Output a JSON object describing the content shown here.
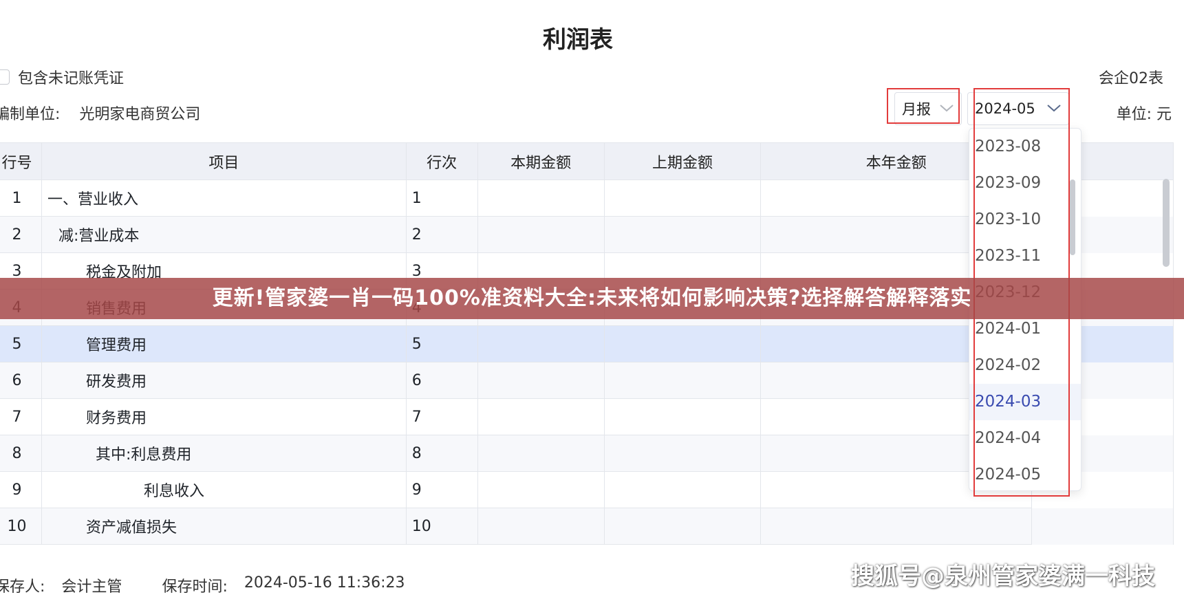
{
  "title": "利润表",
  "include_unposted_label": "包含未记账凭证",
  "form_code": "会企02表",
  "company": {
    "label": "编制单位:",
    "name": "光明家电商贸公司"
  },
  "period_select": {
    "value": "月报"
  },
  "month_select": {
    "value": "2024-05"
  },
  "unit_label": "单位:  元",
  "table": {
    "headers": [
      "行号",
      "项目",
      "行次",
      "本期金额",
      "上期金额",
      "本年金额"
    ],
    "rows": [
      {
        "no": "1",
        "item": "一、营业收入",
        "line": "1"
      },
      {
        "no": "2",
        "item": "减:营业成本",
        "line": "2"
      },
      {
        "no": "3",
        "item": "税金及附加",
        "line": "3"
      },
      {
        "no": "4",
        "item": "销售费用",
        "line": "4"
      },
      {
        "no": "5",
        "item": "管理费用",
        "line": "5"
      },
      {
        "no": "6",
        "item": "研发费用",
        "line": "6"
      },
      {
        "no": "7",
        "item": "财务费用",
        "line": "7"
      },
      {
        "no": "8",
        "item": "其中:利息费用",
        "line": "8"
      },
      {
        "no": "9",
        "item": "利息收入",
        "line": "9"
      },
      {
        "no": "10",
        "item": "资产减值损失",
        "line": "10"
      }
    ]
  },
  "dropdown": {
    "options": [
      "2023-08",
      "2023-09",
      "2023-10",
      "2023-11",
      "2023-12",
      "2024-01",
      "2024-02",
      "2024-03",
      "2024-04",
      "2024-05"
    ],
    "highlighted": "2024-03"
  },
  "banner": "更新!管家婆一肖一码100%准资料大全:未来将如何影响决策?选择解答解释落实",
  "footer": {
    "saver_label": "保存人:",
    "saver": "会计主管",
    "time_label": "保存时间:",
    "time": "2024-05-16 11:36:23"
  },
  "watermark": "搜狐号@泉州管家婆满一科技",
  "colors": {
    "highlight_red": "#e23b3b",
    "selected_row": "#dde7fb",
    "header_bg": "#eef0f6",
    "banner": "#a64848"
  }
}
